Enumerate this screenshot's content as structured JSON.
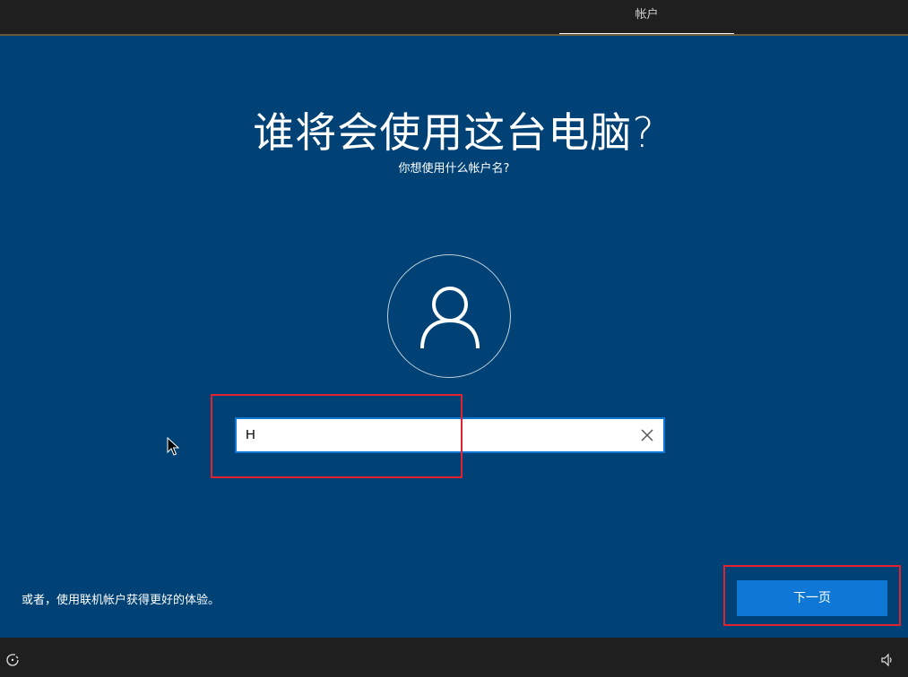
{
  "header": {
    "tab_label": "帐户"
  },
  "main": {
    "title": "谁将会使用这台电脑?",
    "subtitle": "你想使用什么帐户名?",
    "name_input": {
      "value": "H"
    },
    "online_account_link": "或者，使用联机帐户获得更好的体验。",
    "next_button": "下一页"
  },
  "icons": {
    "avatar": "person-icon",
    "clear": "close-icon",
    "accessibility": "accessibility-icon",
    "volume": "volume-icon"
  },
  "colors": {
    "background": "#004275",
    "accent": "#0f78d7",
    "highlight": "#e0232e",
    "bars": "#1f1f1f"
  }
}
